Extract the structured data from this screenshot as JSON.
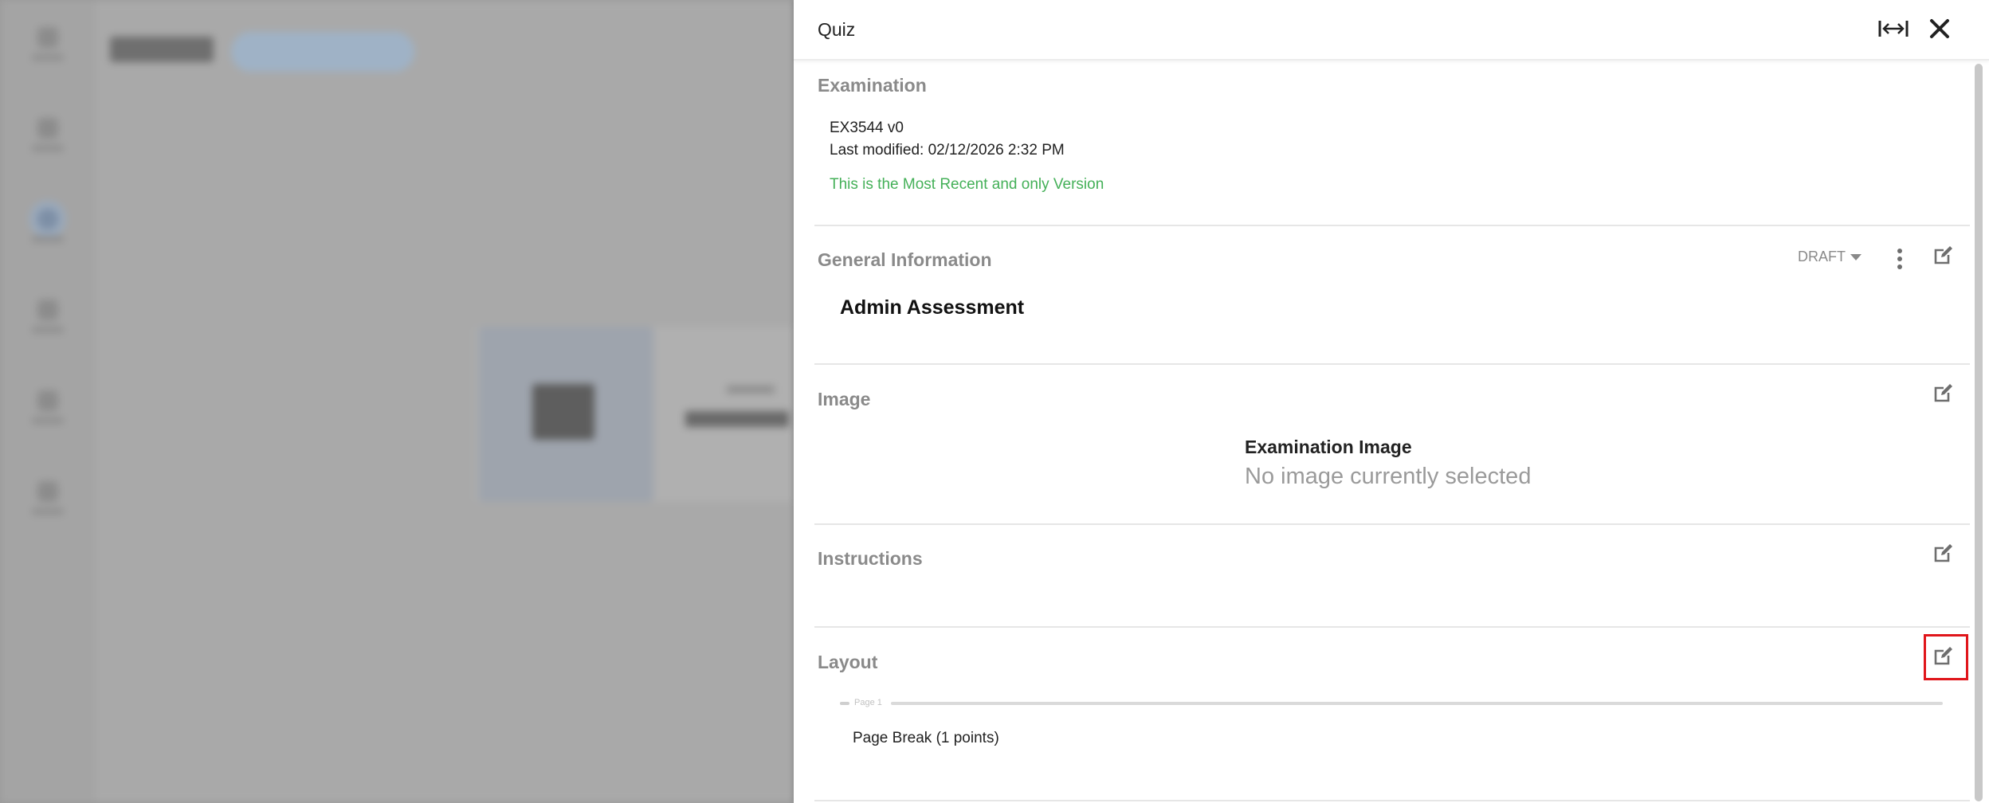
{
  "panel": {
    "title": "Quiz"
  },
  "examination": {
    "title": "Examination",
    "id_version": "EX3544  v0",
    "last_modified": "Last modified: 02/12/2026 2:32 PM",
    "recent_note": "This is the Most Recent and only Version"
  },
  "general": {
    "title": "General Information",
    "status": "DRAFT",
    "name": "Admin Assessment"
  },
  "image": {
    "title": "Image",
    "heading": "Examination Image",
    "empty": "No image currently selected"
  },
  "instructions": {
    "title": "Instructions"
  },
  "layout": {
    "title": "Layout",
    "page_label": "Page 1",
    "item": "Page Break (1 points)"
  },
  "colors": {
    "recent_note": "#44b058",
    "focus_outline": "#e0161b",
    "section_title": "#8a8a8a"
  },
  "icons": {
    "expand": "expand-horizontal-icon",
    "close": "close-icon",
    "edit": "edit-icon",
    "more": "more-vertical-icon",
    "caret": "caret-down-icon"
  }
}
